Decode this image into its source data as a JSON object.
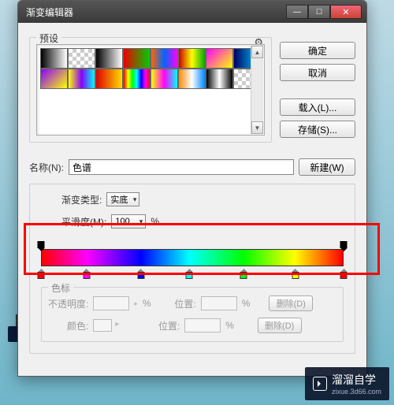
{
  "window": {
    "title": "渐变编辑器"
  },
  "presets": {
    "label": "预设",
    "items": [
      "linear-gradient(90deg,#000,#fff)",
      "checker",
      "linear-gradient(90deg,#000,#fff)",
      "linear-gradient(90deg,#e00,#0c0)",
      "linear-gradient(90deg,#f60,#06f,#f0f)",
      "linear-gradient(90deg,#c00,#ff0,#0a0)",
      "linear-gradient(135deg,#f0f,#ff0)",
      "linear-gradient(90deg,#006,#0cf)",
      "linear-gradient(135deg,#80f,#ff0)",
      "linear-gradient(90deg,#ff0,#80f,#0ff)",
      "linear-gradient(90deg,#d00,#fd0)",
      "linear-gradient(90deg,#f00,#ff0,#0f0,#0ff,#00f,#f0f,#f00)",
      "linear-gradient(90deg,#ff0,#f0f,#0ff)",
      "linear-gradient(90deg,#f80,#fff,#08f)",
      "linear-gradient(90deg,#000,#fff,#000)",
      "checker"
    ]
  },
  "buttons": {
    "ok": "确定",
    "cancel": "取消",
    "load": "载入(L)...",
    "save": "存储(S)...",
    "new": "新建(W)",
    "delete": "删除(D)"
  },
  "name_row": {
    "label": "名称(N):",
    "value": "色谱"
  },
  "type_row": {
    "label": "渐变类型:",
    "value": "实底"
  },
  "smooth_row": {
    "label": "平滑度(M):",
    "value": "100",
    "unit": "%"
  },
  "stops_group": {
    "title": "色标",
    "opacity_label": "不透明度:",
    "position_label": "位置:",
    "color_label": "颜色:",
    "unit": "%"
  },
  "gradient": {
    "opacity_stops": [
      0,
      100
    ],
    "color_stops": [
      {
        "pos": 0,
        "color": "#ff0000"
      },
      {
        "pos": 15,
        "color": "#ff00ff"
      },
      {
        "pos": 33,
        "color": "#0000ff"
      },
      {
        "pos": 49,
        "color": "#00ffff"
      },
      {
        "pos": 67,
        "color": "#00ff00"
      },
      {
        "pos": 84,
        "color": "#ffff00"
      },
      {
        "pos": 100,
        "color": "#ff0000"
      }
    ]
  },
  "watermark": {
    "text": "溜溜自学",
    "sub": "zixue.3d66.com"
  }
}
